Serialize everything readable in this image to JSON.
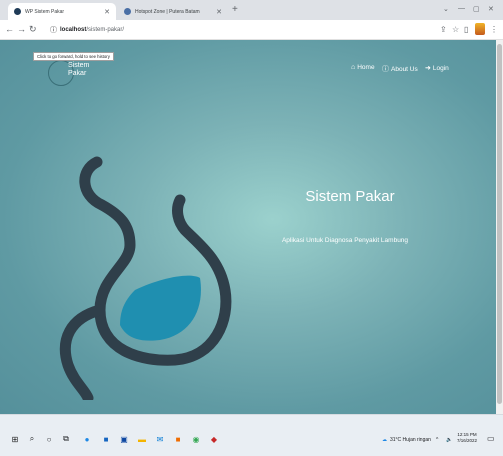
{
  "browser": {
    "tabs": [
      {
        "title": "WP Sistem Pakar",
        "favicon_color": "#1f3b57",
        "active": true
      },
      {
        "title": "Hotspot Zone | Putera Batam",
        "favicon_color": "#4a6fa5",
        "active": false
      }
    ],
    "new_tab": "+",
    "address": {
      "host": "localhost",
      "path": "/sistem-pakar/"
    },
    "tooltip": "Click to go forward, hold to see history"
  },
  "page": {
    "brand": {
      "line1": "Sistem",
      "line2": "Pakar"
    },
    "nav": [
      {
        "icon": "home-icon",
        "label": "Home"
      },
      {
        "icon": "info-icon",
        "label": "About Us"
      },
      {
        "icon": "login-icon",
        "label": "Login"
      }
    ],
    "hero": {
      "title": "Sistem Pakar",
      "subtitle": "Aplikasi Untuk Diagnosa Penyakit Lambung"
    },
    "colors": {
      "stomach_outline": "#2f3f4a",
      "stomach_fill": "#1f8fb0"
    }
  },
  "taskbar": {
    "weather": "31°C  Hujan ringan",
    "time": "12:15 PM",
    "date": "7/16/2022"
  }
}
